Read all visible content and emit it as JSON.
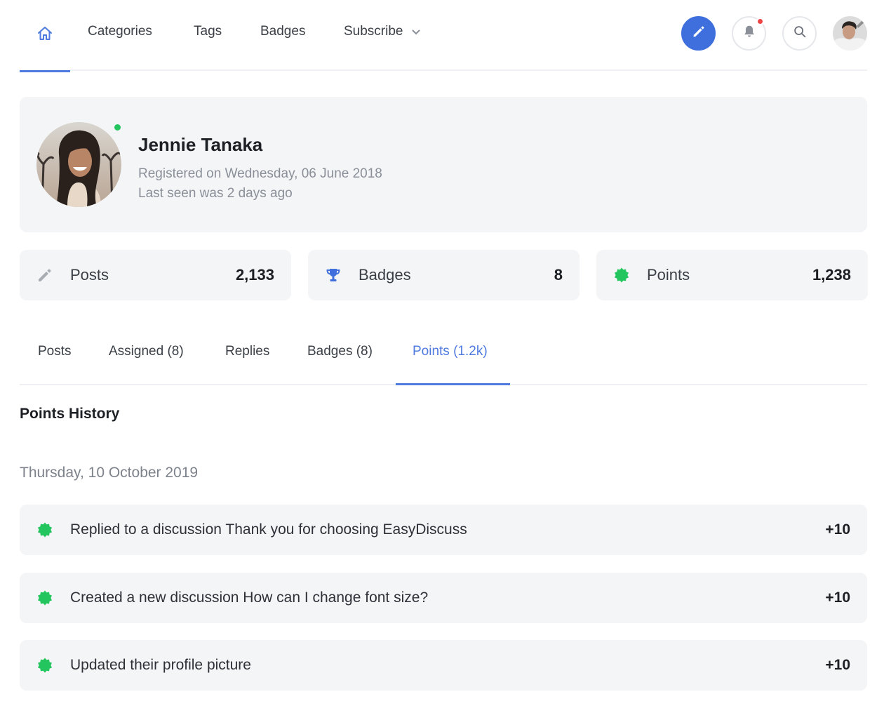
{
  "nav": {
    "home_icon": "home-icon",
    "links": {
      "categories": "Categories",
      "tags": "Tags",
      "badges": "Badges",
      "subscribe": "Subscribe"
    },
    "actions": {
      "compose_icon": "pencil-icon",
      "notifications_icon": "bell-icon",
      "search_icon": "search-icon"
    },
    "accent_color": "#4f7ae0",
    "notification_dot_color": "#ef4444"
  },
  "profile": {
    "name": "Jennie Tanaka",
    "registered": "Registered on Wednesday, 06 June 2018",
    "last_seen": "Last seen was 2 days ago",
    "online_color": "#22c55e"
  },
  "stats": {
    "posts": {
      "label": "Posts",
      "value": "2,133",
      "icon": "pencil-icon"
    },
    "badges": {
      "label": "Badges",
      "value": "8",
      "icon": "trophy-icon"
    },
    "points": {
      "label": "Points",
      "value": "1,238",
      "icon": "points-badge-icon"
    }
  },
  "tabs": {
    "posts": "Posts",
    "assigned": "Assigned (8)",
    "replies": "Replies",
    "badges": "Badges (8)",
    "points": "Points (1.2k)",
    "active": "points"
  },
  "history": {
    "title": "Points History",
    "date": "Thursday, 10 October 2019",
    "items": [
      {
        "text": "Replied to a discussion Thank you for choosing EasyDiscuss",
        "points": "+10"
      },
      {
        "text": "Created a new discussion How can I change font size?",
        "points": "+10"
      },
      {
        "text": "Updated their profile picture",
        "points": "+10"
      }
    ],
    "icon_color": "#22c55e"
  }
}
